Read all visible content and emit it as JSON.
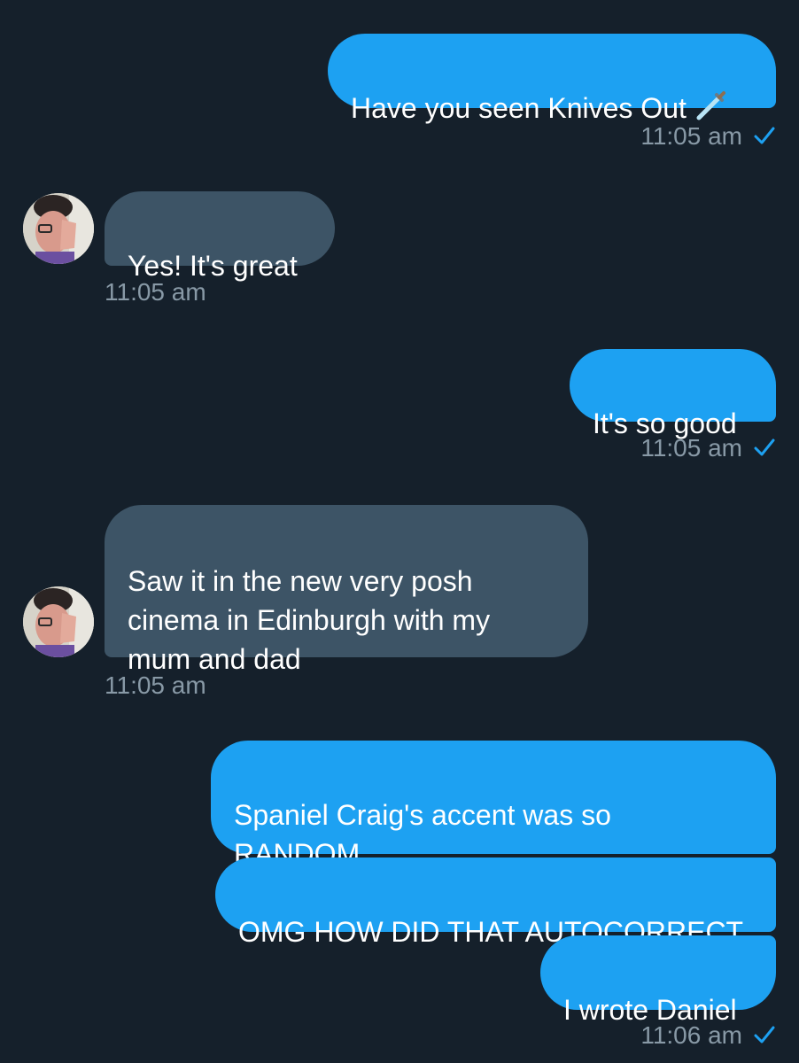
{
  "theme": {
    "background": "#15202b",
    "sent_bubble": "#1da1f2",
    "received_bubble": "#3d5466",
    "meta_text": "#8899a6",
    "read_check": "#1da1f2"
  },
  "messages": [
    {
      "direction": "sent",
      "text": "Have you seen Knives Out",
      "emoji": "dagger-icon",
      "time": "11:05 am",
      "read": true
    },
    {
      "direction": "received",
      "text": "Yes! It's great",
      "time": "11:05 am",
      "avatar": "contact-avatar"
    },
    {
      "direction": "sent",
      "text": "It's so good",
      "time": "11:05 am",
      "read": true
    },
    {
      "direction": "received",
      "text": "Saw it in the new very posh\ncinema in Edinburgh with my\nmum and dad",
      "time": "11:05 am",
      "avatar": "contact-avatar"
    },
    {
      "direction": "sent",
      "text": "Spaniel Craig's accent was so\nRANDOM"
    },
    {
      "direction": "sent",
      "text": "OMG HOW DID THAT AUTOCORRECT"
    },
    {
      "direction": "sent",
      "text": "I wrote Daniel",
      "time": "11:06 am",
      "read": true
    }
  ]
}
